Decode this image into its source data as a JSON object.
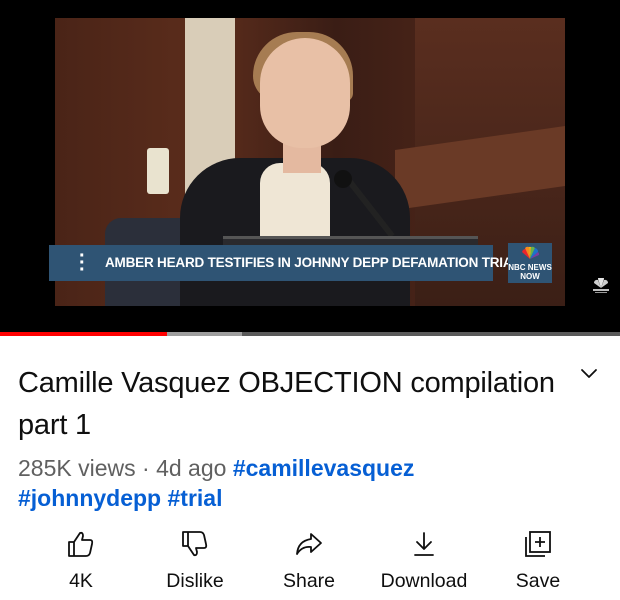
{
  "video": {
    "lower_third": "AMBER HEARD TESTIFIES IN JOHNNY DEPP DEFAMATION TRIAL",
    "network_line1": "NBC NEWS",
    "network_line2": "NOW",
    "progress_fraction": 0.27,
    "buffered_fraction": 0.39,
    "accent_color": "#ff0000"
  },
  "title": "Camille Vasquez OBJECTION compilation part 1",
  "meta": {
    "views": "285K views",
    "separator": "·",
    "age": "4d ago",
    "hashtags": [
      "#camillevasquez",
      "#johnnydepp",
      "#trial"
    ],
    "hashtag_color": "#065fd4"
  },
  "actions": [
    {
      "label": "4K",
      "icon": "thumbs-up-icon"
    },
    {
      "label": "Dislike",
      "icon": "thumbs-down-icon"
    },
    {
      "label": "Share",
      "icon": "share-arrow-icon"
    },
    {
      "label": "Download",
      "icon": "download-icon"
    },
    {
      "label": "Save",
      "icon": "save-playlist-icon"
    }
  ]
}
